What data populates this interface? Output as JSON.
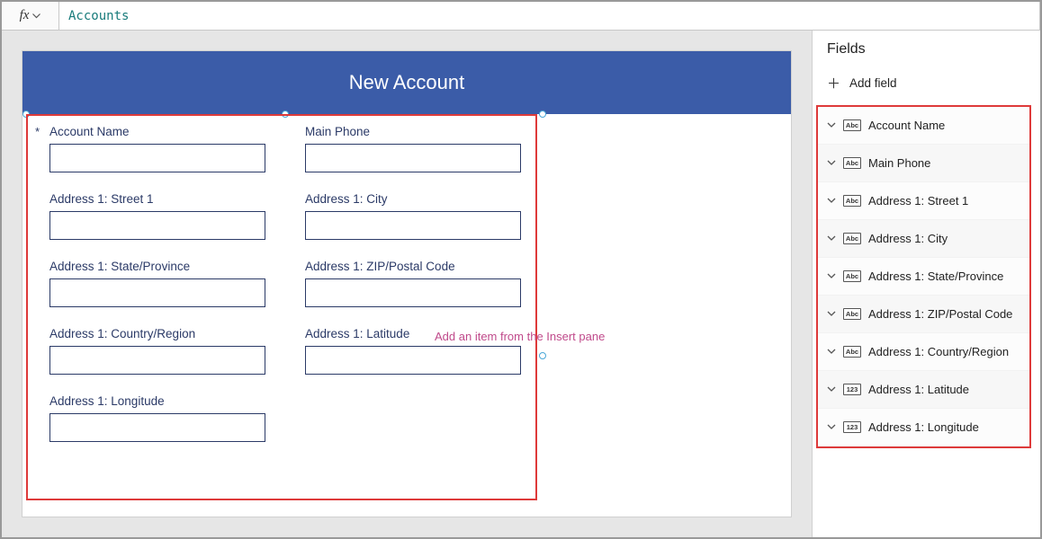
{
  "formula": {
    "fx_label": "fx",
    "value": "Accounts"
  },
  "canvas": {
    "title": "New Account",
    "hint": "Add an item from the Insert pane",
    "required_marker": "*",
    "fields": [
      {
        "label": "Account Name"
      },
      {
        "label": "Main Phone"
      },
      {
        "label": "Address 1: Street 1"
      },
      {
        "label": "Address 1: City"
      },
      {
        "label": "Address 1: State/Province"
      },
      {
        "label": "Address 1: ZIP/Postal Code"
      },
      {
        "label": "Address 1: Country/Region"
      },
      {
        "label": "Address 1: Latitude"
      },
      {
        "label": "Address 1: Longitude"
      }
    ]
  },
  "panel": {
    "title": "Fields",
    "add_label": "Add field",
    "items": [
      {
        "type": "Abc",
        "label": "Account Name"
      },
      {
        "type": "Abc",
        "label": "Main Phone"
      },
      {
        "type": "Abc",
        "label": "Address 1: Street 1"
      },
      {
        "type": "Abc",
        "label": "Address 1: City"
      },
      {
        "type": "Abc",
        "label": "Address 1: State/Province"
      },
      {
        "type": "Abc",
        "label": "Address 1: ZIP/Postal Code"
      },
      {
        "type": "Abc",
        "label": "Address 1: Country/Region"
      },
      {
        "type": "123",
        "label": "Address 1: Latitude"
      },
      {
        "type": "123",
        "label": "Address 1: Longitude"
      }
    ]
  }
}
